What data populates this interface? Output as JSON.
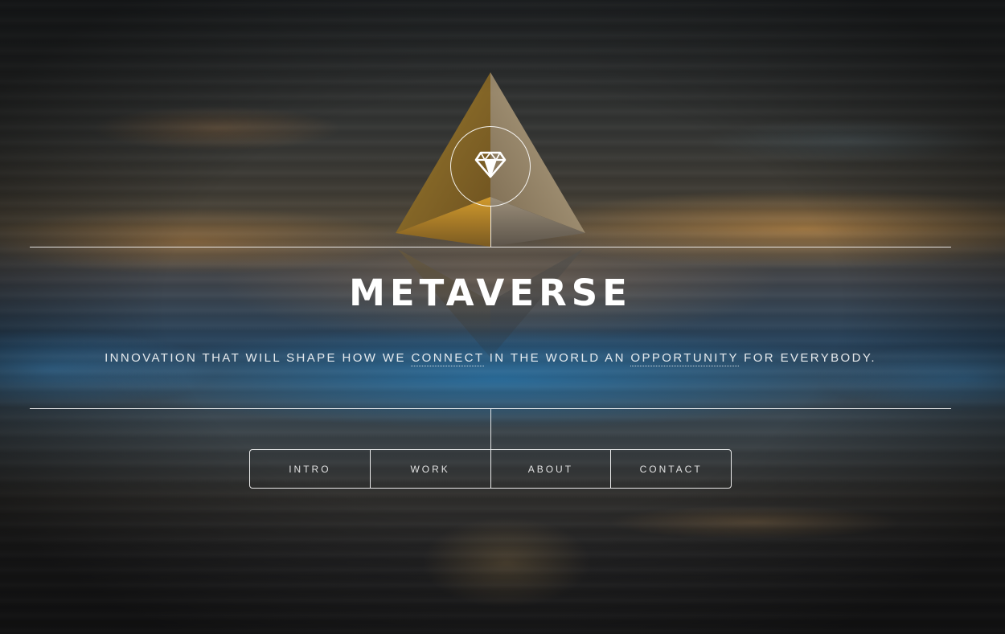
{
  "header": {
    "logo_icon": "gem-icon",
    "title": "METAVERSE",
    "tagline": {
      "part1": "INNOVATION THAT WILL SHAPE HOW WE ",
      "link1": "CONNECT",
      "part2": " IN THE WORLD AN ",
      "link2": "OPPORTUNITY",
      "part3": " FOR EVERYBODY."
    }
  },
  "nav": {
    "items": [
      {
        "label": "INTRO"
      },
      {
        "label": "WORK"
      },
      {
        "label": "ABOUT"
      },
      {
        "label": "CONTACT"
      }
    ]
  },
  "colors": {
    "text": "#ffffff",
    "ethereum_gold": "#c9a24a"
  }
}
